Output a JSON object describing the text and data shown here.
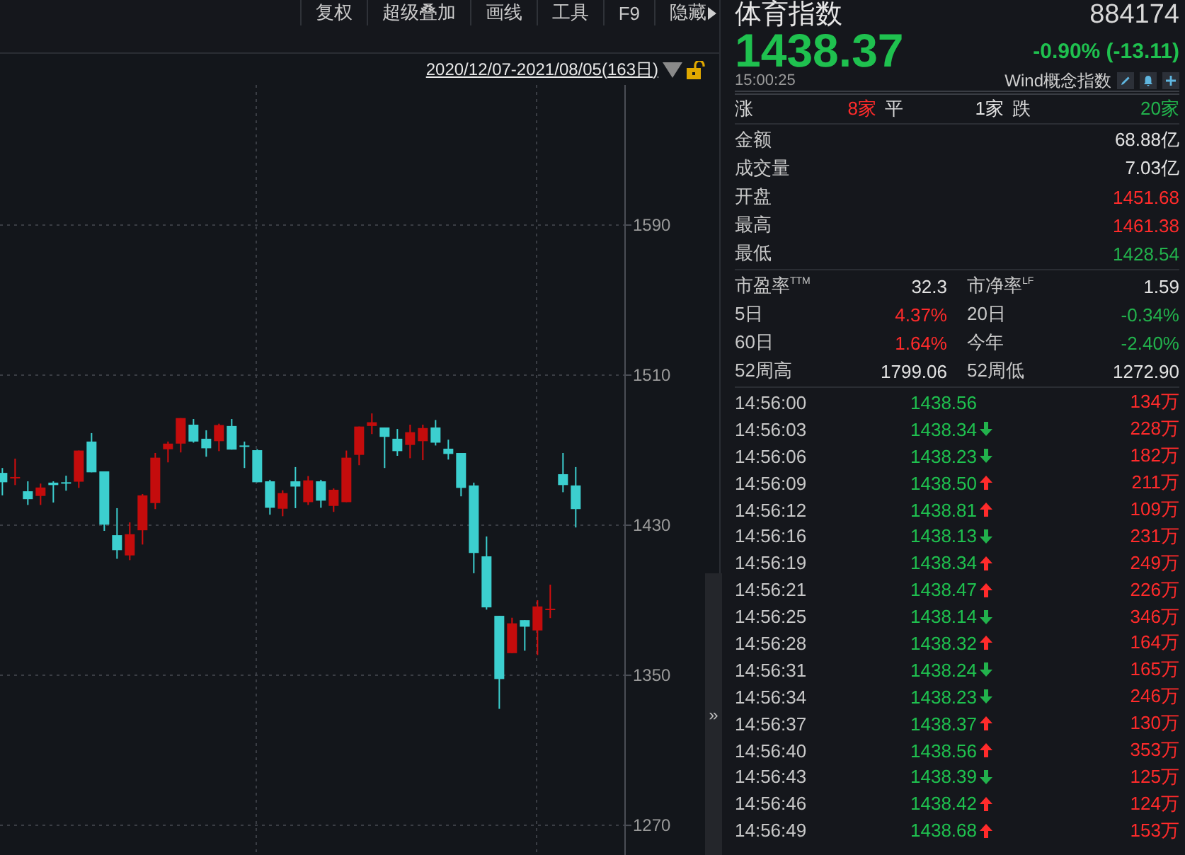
{
  "toolbar": {
    "buttons": [
      {
        "label": "复权"
      },
      {
        "label": "超级叠加"
      },
      {
        "label": "画线"
      },
      {
        "label": "工具"
      },
      {
        "label": "F9"
      },
      {
        "label": "隐藏"
      }
    ]
  },
  "chart": {
    "date_range": "2020/12/07-2021/08/05(163日)",
    "chart_data": {
      "type": "candlestick",
      "categories": [
        null,
        null,
        null,
        null,
        null,
        null,
        null,
        null,
        null,
        null,
        null,
        null,
        null,
        null,
        null,
        null,
        null,
        null,
        null,
        null,
        null,
        null,
        null,
        null,
        null,
        null,
        null,
        null,
        null,
        null,
        null,
        null,
        null,
        null,
        null,
        null,
        null,
        null,
        null,
        null,
        null,
        null,
        null,
        null,
        null,
        null
      ],
      "ohlc": [
        [
          1457.9,
          1460.5,
          1445.9,
          1452.9
        ],
        [
          1455.2,
          1465.5,
          1451.4,
          1455.7
        ],
        [
          1448.1,
          1453.4,
          1440.8,
          1443.9
        ],
        [
          1445.6,
          1452.2,
          1440.8,
          1450.1
        ],
        [
          1452.7,
          1453.4,
          1442.1,
          1451.4
        ],
        [
          1452.9,
          1456.4,
          1448.4,
          1452.4
        ],
        [
          1453.2,
          1469.8,
          1449.9,
          1469.8
        ],
        [
          1474.6,
          1479.1,
          1458.2,
          1458.2
        ],
        [
          1458.7,
          1458.7,
          1427.0,
          1430.3
        ],
        [
          1424.7,
          1439.1,
          1412.1,
          1416.7
        ],
        [
          1413.9,
          1431.5,
          1411.4,
          1425.2
        ],
        [
          1427.3,
          1446.6,
          1419.7,
          1445.9
        ],
        [
          1441.8,
          1468.5,
          1438.6,
          1466.0
        ],
        [
          1470.5,
          1474.6,
          1463.5,
          1473.5
        ],
        [
          1473.5,
          1487.1,
          1468.8,
          1487.1
        ],
        [
          1483.6,
          1486.6,
          1474.0,
          1474.6
        ],
        [
          1476.1,
          1480.6,
          1466.5,
          1471.0
        ],
        [
          1474.8,
          1484.1,
          1469.5,
          1483.4
        ],
        [
          1482.9,
          1486.6,
          1470.3,
          1470.3
        ],
        [
          1472.5,
          1474.6,
          1460.5,
          1472.0
        ],
        [
          1470.0,
          1470.5,
          1452.9,
          1452.9
        ],
        [
          1453.4,
          1454.2,
          1435.6,
          1439.3
        ],
        [
          1438.8,
          1448.6,
          1434.8,
          1447.1
        ],
        [
          1453.4,
          1461.0,
          1439.1,
          1450.6
        ],
        [
          1442.3,
          1456.2,
          1440.8,
          1453.9
        ],
        [
          1453.4,
          1454.2,
          1439.3,
          1443.1
        ],
        [
          1440.3,
          1449.6,
          1437.1,
          1448.9
        ],
        [
          1442.3,
          1469.8,
          1442.3,
          1466.0
        ],
        [
          1467.5,
          1482.6,
          1462.0,
          1482.6
        ],
        [
          1482.9,
          1489.6,
          1478.6,
          1484.9
        ],
        [
          1482.1,
          1482.1,
          1460.5,
          1477.1
        ],
        [
          1476.1,
          1481.3,
          1467.0,
          1469.5
        ],
        [
          1472.8,
          1483.6,
          1465.7,
          1479.6
        ],
        [
          1474.8,
          1483.6,
          1464.7,
          1481.8
        ],
        [
          1482.1,
          1486.1,
          1472.5,
          1474.0
        ],
        [
          1470.8,
          1475.6,
          1465.0,
          1468.0
        ],
        [
          1468.5,
          1468.5,
          1445.4,
          1449.9
        ],
        [
          1451.2,
          1452.7,
          1404.4,
          1415.2
        ],
        [
          1413.4,
          1424.0,
          1385.0,
          1386.2
        ],
        [
          1381.7,
          1381.7,
          1332.1,
          1348.0
        ],
        [
          1361.8,
          1380.7,
          1361.8,
          1377.7
        ],
        [
          1379.4,
          1379.4,
          1363.1,
          1375.9
        ],
        [
          1373.9,
          1390.0,
          1360.8,
          1386.7
        ],
        [
          1385.0,
          1398.3,
          1380.5,
          1385.5
        ],
        [
          1457.2,
          1468.5,
          1447.6,
          1451.4
        ],
        [
          1451.2,
          1461.0,
          1428.8,
          1438.6
        ]
      ],
      "ylim": [
        1254.2,
        1664.7
      ],
      "grid": true,
      "yticks": [
        {
          "value": 1590,
          "label": "1590"
        },
        {
          "value": 1510,
          "label": "1510"
        },
        {
          "value": 1430,
          "label": "1430"
        },
        {
          "value": 1350,
          "label": "1350"
        },
        {
          "value": 1270,
          "label": "1270"
        }
      ]
    }
  },
  "side_tab": {
    "label": "»"
  },
  "quote": {
    "name": "体育指数",
    "code": "884174",
    "price": "1438.37",
    "change": "-0.90% (-13.11)",
    "time": "15:00:25",
    "category": "Wind概念指数"
  },
  "breadth": [
    {
      "label": "涨",
      "value": "8家",
      "color": "#ff2b2b"
    },
    {
      "label": "平",
      "value": "1家",
      "color": "#e2e2e2"
    },
    {
      "label": "跌",
      "value": "20家",
      "color": "#22b24c"
    }
  ],
  "stats": [
    {
      "label": "金额",
      "value": "68.88亿",
      "color": "#e2e2e2"
    },
    {
      "label": "成交量",
      "value": "7.03亿",
      "color": "#e2e2e2"
    },
    {
      "label": "开盘",
      "value": "1451.68",
      "color": "#ff2b2b"
    },
    {
      "label": "最高",
      "value": "1461.38",
      "color": "#ff2b2b"
    },
    {
      "label": "最低",
      "value": "1428.54",
      "color": "#22b24c"
    }
  ],
  "ratios": [
    {
      "label": "市盈率$^{TTM}$",
      "value": "32.3",
      "color": "#e2e2e2"
    },
    {
      "label": "市净率$^{LF}$",
      "value": "1.59",
      "color": "#e2e2e2"
    },
    {
      "label": "5日",
      "value": "4.37%",
      "color": "#ff2b2b"
    },
    {
      "label": "20日",
      "value": "-0.34%",
      "color": "#22b24c"
    },
    {
      "label": "60日",
      "value": "1.64%",
      "color": "#ff2b2b"
    },
    {
      "label": "今年",
      "value": "-2.40%",
      "color": "#22b24c"
    },
    {
      "label": "52周高",
      "value": "1799.06",
      "color": "#e2e2e2"
    },
    {
      "label": "52周低",
      "value": "1272.90",
      "color": "#e2e2e2"
    }
  ],
  "ticks": [
    {
      "time": "14:56:00",
      "price": "1438.56",
      "kind": "plain",
      "volume": "134万"
    },
    {
      "time": "14:56:03",
      "price": "1438.34",
      "kind": "down",
      "volume": "228万"
    },
    {
      "time": "14:56:06",
      "price": "1438.23",
      "kind": "down",
      "volume": "182万"
    },
    {
      "time": "14:56:09",
      "price": "1438.50",
      "kind": "up",
      "volume": "211万"
    },
    {
      "time": "14:56:12",
      "price": "1438.81",
      "kind": "up",
      "volume": "109万"
    },
    {
      "time": "14:56:16",
      "price": "1438.13",
      "kind": "down",
      "volume": "231万"
    },
    {
      "time": "14:56:19",
      "price": "1438.34",
      "kind": "up",
      "volume": "249万"
    },
    {
      "time": "14:56:21",
      "price": "1438.47",
      "kind": "up",
      "volume": "226万"
    },
    {
      "time": "14:56:25",
      "price": "1438.14",
      "kind": "down",
      "volume": "346万"
    },
    {
      "time": "14:56:28",
      "price": "1438.32",
      "kind": "up",
      "volume": "164万"
    },
    {
      "time": "14:56:31",
      "price": "1438.24",
      "kind": "down",
      "volume": "165万"
    },
    {
      "time": "14:56:34",
      "price": "1438.23",
      "kind": "down",
      "volume": "246万"
    },
    {
      "time": "14:56:37",
      "price": "1438.37",
      "kind": "up",
      "volume": "130万"
    },
    {
      "time": "14:56:40",
      "price": "1438.56",
      "kind": "up",
      "volume": "353万"
    },
    {
      "time": "14:56:43",
      "price": "1438.39",
      "kind": "down",
      "volume": "125万"
    },
    {
      "time": "14:56:46",
      "price": "1438.42",
      "kind": "up",
      "volume": "124万"
    },
    {
      "time": "14:56:49",
      "price": "1438.68",
      "kind": "up",
      "volume": "153万"
    }
  ]
}
